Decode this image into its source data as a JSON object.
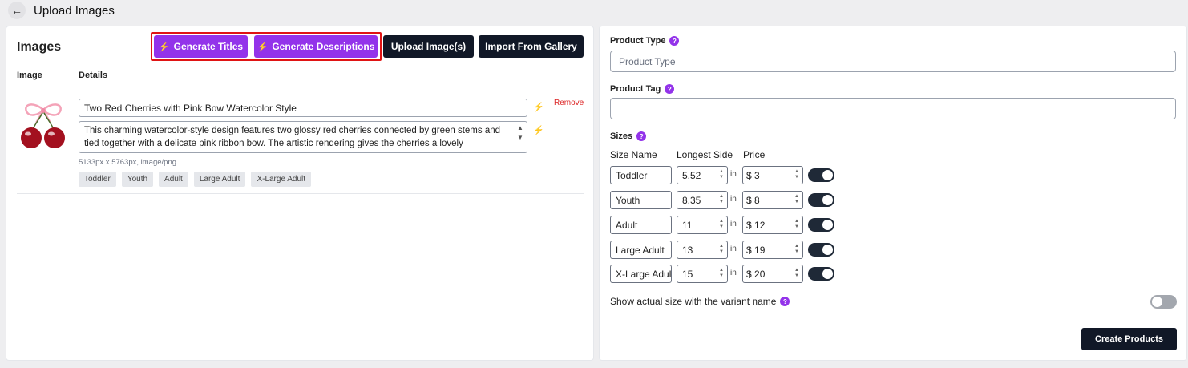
{
  "header": {
    "title": "Upload Images"
  },
  "images_panel": {
    "title": "Images",
    "buttons": {
      "generate_titles": "Generate Titles",
      "generate_descriptions": "Generate Descriptions",
      "upload_images": "Upload Image(s)",
      "import_gallery": "Import From Gallery"
    },
    "columns": {
      "image": "Image",
      "details": "Details"
    },
    "item": {
      "title": "Two Red Cherries with Pink Bow Watercolor Style",
      "description": "This charming watercolor-style design features two glossy red cherries connected by green stems and tied together with a delicate pink ribbon bow. The artistic rendering gives the cherries a lovely",
      "meta": "5133px x 5763px, image/png",
      "remove": "Remove",
      "sizes": [
        "Toddler",
        "Youth",
        "Adult",
        "Large Adult",
        "X-Large Adult"
      ]
    }
  },
  "product_panel": {
    "product_type_label": "Product Type",
    "product_type_placeholder": "Product Type",
    "product_tag_label": "Product Tag",
    "product_tag_value": "",
    "sizes_label": "Sizes",
    "columns": {
      "name": "Size Name",
      "side": "Longest Side",
      "price": "Price"
    },
    "unit": "in",
    "currency": "$",
    "sizes": [
      {
        "name": "Toddler",
        "side": "5.52",
        "price": "3",
        "enabled": true
      },
      {
        "name": "Youth",
        "side": "8.35",
        "price": "8",
        "enabled": true
      },
      {
        "name": "Adult",
        "side": "11",
        "price": "12",
        "enabled": true
      },
      {
        "name": "Large Adult",
        "side": "13",
        "price": "19",
        "enabled": true
      },
      {
        "name": "X-Large Adult",
        "side": "15",
        "price": "20",
        "enabled": true
      }
    ],
    "show_actual_size_label": "Show actual size with the variant name",
    "show_actual_size": false,
    "create_button": "Create Products"
  },
  "colors": {
    "accent": "#9333ea",
    "dark": "#111827",
    "danger": "#dc2626"
  },
  "icons": [
    "back-arrow-icon",
    "magic-wand-icon",
    "help-icon",
    "spinner-arrows-icon"
  ]
}
